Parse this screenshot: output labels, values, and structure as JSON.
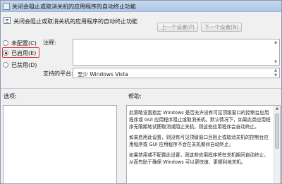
{
  "window": {
    "title": "关闭会阻止或取消关机的应用程序的自动终止功能"
  },
  "header": {
    "policy_title": "关闭会阻止或取消关机的应用程序的自动终止功能"
  },
  "nav": {
    "prev_label": "上一个设置(P)",
    "next_label": "下一个设置(N)"
  },
  "options": {
    "not_configured": "未配置(C)",
    "enabled": "已启用(E)",
    "disabled": "已禁用(D)",
    "selected": "enabled",
    "highlight_color": "#e23a3a"
  },
  "fields": {
    "comment_label": "注释:",
    "comment_value": "",
    "supported_label": "支持的平台:",
    "supported_value": "至少 Windows Vista"
  },
  "sections": {
    "options_label": "选项:",
    "help_label": "帮助:"
  },
  "help": {
    "p1": "此策略设置指定 Windows 是否允许没有可见顶级窗口的控制台应用程序或 GUI 应用程序阻止或取消关机。默认情况下，如果此类应用程序无限期地试图取消或阻止关机，则这些应用程序会自动终止。",
    "p2": "如果启用此设置，则没有可见顶级窗口且阻止或取消关机的控制台应用程序或 GUI 应用程序不会在关机期间自动终止。",
    "p3": "如果禁用或不配置此设置，则这些应用程序将在关机期间自动终止，从而有助于确保 Windows 可以更快速、更顺利地关机。"
  }
}
